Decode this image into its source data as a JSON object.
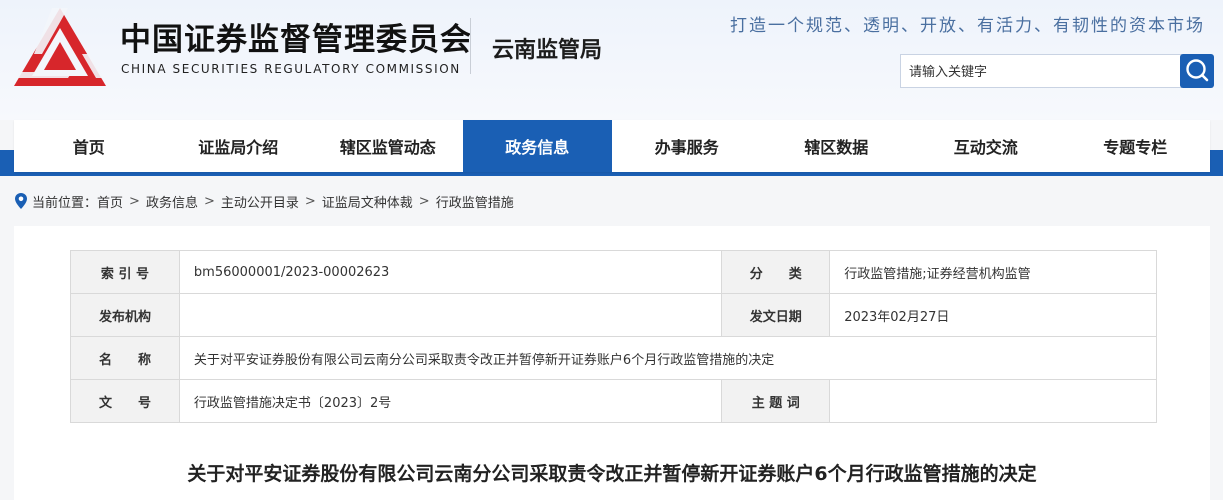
{
  "header": {
    "org_name_cn": "中国证券监督管理委员会",
    "org_name_en": "CHINA SECURITIES REGULATORY COMMISSION",
    "bureau_name": "云南监管局",
    "slogan": "打造一个规范、透明、开放、有活力、有韧性的资本市场",
    "search_placeholder": "请输入关键字",
    "brand_color": "#1a5fb4",
    "logo_color": "#d7262b"
  },
  "nav": {
    "items": [
      {
        "label": "首页"
      },
      {
        "label": "证监局介绍"
      },
      {
        "label": "辖区监管动态"
      },
      {
        "label": "政务信息",
        "active": true
      },
      {
        "label": "办事服务"
      },
      {
        "label": "辖区数据"
      },
      {
        "label": "互动交流"
      },
      {
        "label": "专题专栏"
      }
    ]
  },
  "breadcrumb": {
    "prefix": "当前位置：",
    "items": [
      "首页",
      "政务信息",
      "主动公开目录",
      "证监局文种体裁",
      "行政监管措施"
    ],
    "separator": ">"
  },
  "meta_table": {
    "index_label": "索 引 号",
    "index_value": "bm56000001/2023-00002623",
    "category_label": "分　　类",
    "category_value": "行政监管措施;证券经营机构监管",
    "publisher_label": "发布机构",
    "publisher_value": "",
    "date_label": "发文日期",
    "date_value": "2023年02月27日",
    "name_label": "名　　称",
    "name_value": "关于对平安证券股份有限公司云南分公司采取责令改正并暂停新开证券账户6个月行政监管措施的决定",
    "docno_label": "文　　号",
    "docno_value": "行政监管措施决定书〔2023〕2号",
    "keywords_label": "主 题 词",
    "keywords_value": ""
  },
  "document": {
    "title": "关于对平安证券股份有限公司云南分公司采取责令改正并暂停新开证券账户6个月行政监管措施的决定"
  }
}
